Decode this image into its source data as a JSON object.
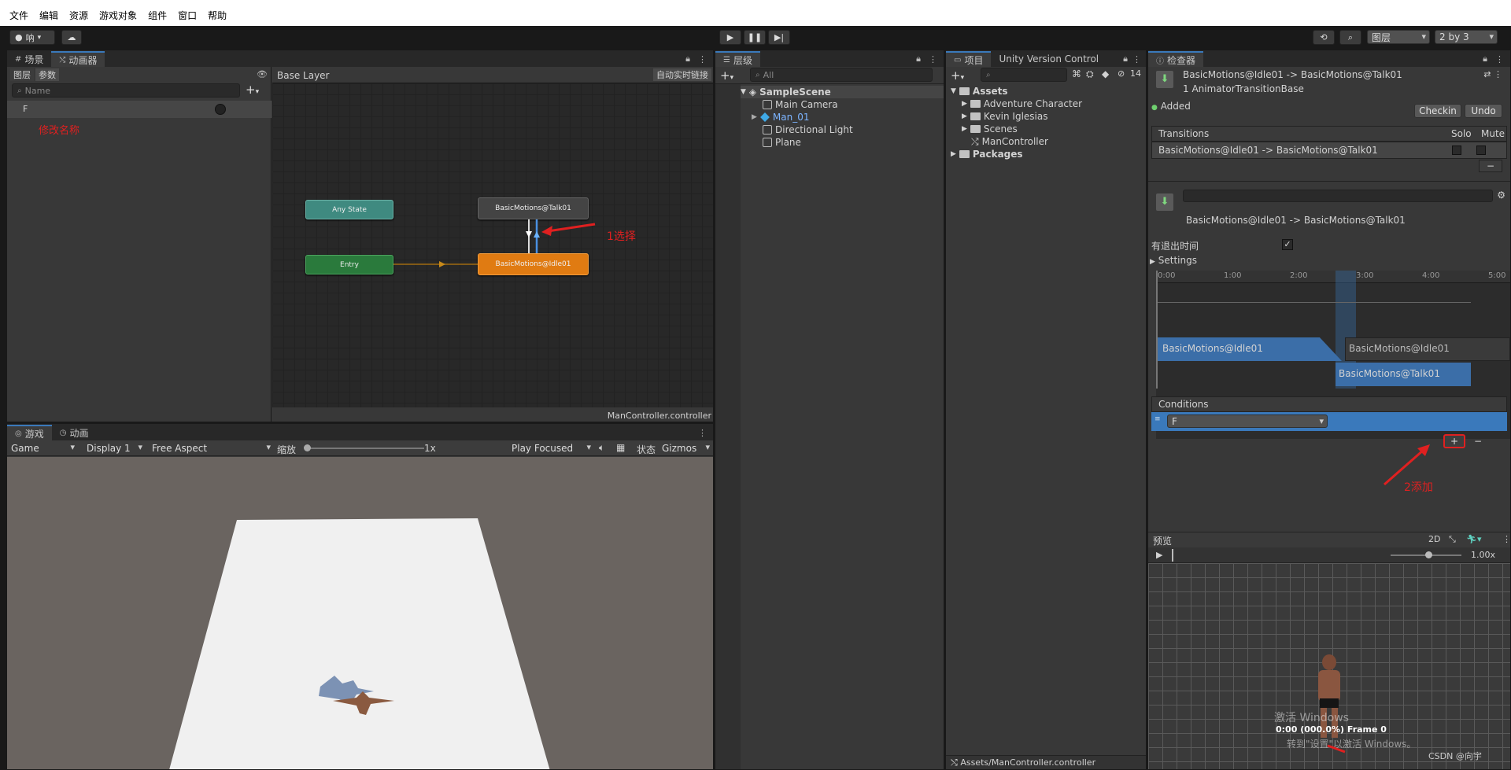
{
  "menu": [
    "文件",
    "编辑",
    "资源",
    "游戏对象",
    "组件",
    "窗口",
    "帮助"
  ],
  "toolbar": {
    "account": "呐",
    "layers": "图层",
    "layout": "2 by 3"
  },
  "animator": {
    "tab_scene": "场景",
    "tab_animator": "动画器",
    "subtab_layers": "图层",
    "subtab_params": "参数",
    "search_placeholder": "Name",
    "param_name": "F",
    "note_rename": "修改名称",
    "breadcrumb": "Base Layer",
    "auto_live_link": "自动实时链接",
    "states": {
      "any": "Any State",
      "entry": "Entry",
      "talk": "BasicMotions@Talk01",
      "idle": "BasicMotions@Idle01"
    },
    "annotation_select": "1选择",
    "footer": "ManController.controller"
  },
  "game": {
    "tab_game": "游戏",
    "tab_animation": "动画",
    "mode": "Game",
    "display": "Display 1",
    "aspect": "Free Aspect",
    "scale_label": "缩放",
    "scale_value": "1x",
    "play_focused": "Play Focused",
    "stats": "状态",
    "gizmos": "Gizmos"
  },
  "hierarchy": {
    "tab": "层级",
    "search_placeholder": "All",
    "scene": "SampleScene",
    "items": [
      "Main Camera",
      "Man_01",
      "Directional Light",
      "Plane"
    ]
  },
  "project": {
    "tab": "项目",
    "tab_uvc": "Unity Version Control",
    "hidden_count": "14",
    "assets": "Assets",
    "items": [
      "Adventure Character",
      "Kevin Iglesias",
      "Scenes",
      "ManController"
    ],
    "packages": "Packages",
    "footer_path": "Assets/ManController.controller"
  },
  "inspector": {
    "tab": "检查器",
    "title": "BasicMotions@Idle01 -> BasicMotions@Talk01",
    "subtitle": "1 AnimatorTransitionBase",
    "added": "Added",
    "checkin": "Checkin",
    "undo": "Undo",
    "transitions_header": "Transitions",
    "solo": "Solo",
    "mute": "Mute",
    "transition_row": "BasicMotions@Idle01 -> BasicMotions@Talk01",
    "transition_name": "BasicMotions@Idle01 -> BasicMotions@Talk01",
    "has_exit_time": "有退出时间",
    "settings": "Settings",
    "timeline_ticks": [
      "0:00",
      "1:00",
      "2:00",
      "3:00",
      "4:00",
      "5:00"
    ],
    "clip_idle_a": "BasicMotions@Idle01",
    "clip_idle_b": "BasicMotions@Idle01",
    "clip_talk": "BasicMotions@Talk01",
    "conditions_header": "Conditions",
    "condition_param": "F",
    "annotation_add": "2添加",
    "preview_label": "预览",
    "preview_2d": "2D",
    "preview_speed": "1.00x",
    "preview_frame": "0:00 (000.0%) Frame 0",
    "watermark_1": "激活 Windows",
    "watermark_2": "转到\"设置\"以激活 Windows。",
    "watermark_3": "CSDN @向宇"
  },
  "colors": {
    "accent": "#3a79bb",
    "state_orange": "#e07b12",
    "state_green": "#2a7a3c",
    "state_teal": "#3f8a80",
    "annotation_red": "#e02020"
  }
}
